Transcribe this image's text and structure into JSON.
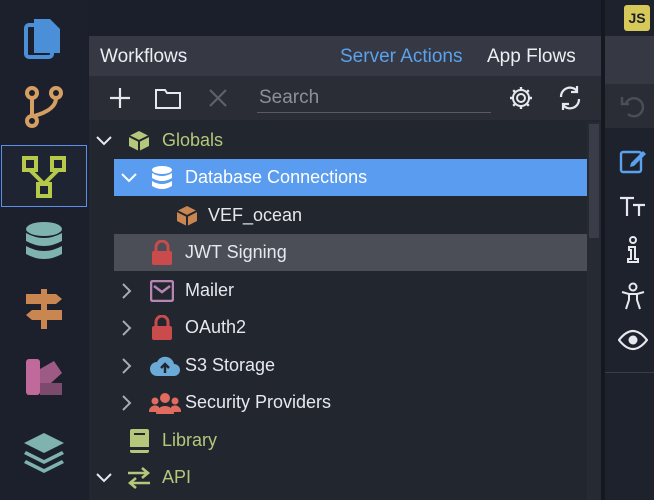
{
  "panel": {
    "title": "Workflows",
    "tabs": [
      "Server Actions",
      "App Flows"
    ]
  },
  "toolbar": {
    "search_placeholder": "Search",
    "buttons": [
      "add-icon",
      "new-folder-icon",
      "delete-icon",
      "settings-icon",
      "refresh-icon"
    ]
  },
  "tree": {
    "items": [
      {
        "label": "Globals",
        "icon": "cube-icon",
        "expanded": true
      },
      {
        "label": "Database Connections",
        "icon": "database-icon",
        "expanded": true,
        "selected": true
      },
      {
        "label": "VEF_ocean",
        "icon": "box-icon"
      },
      {
        "label": "JWT Signing",
        "icon": "lock-icon"
      },
      {
        "label": "Mailer",
        "icon": "mail-icon",
        "expanded": false
      },
      {
        "label": "OAuth2",
        "icon": "lock-icon",
        "expanded": false
      },
      {
        "label": "S3 Storage",
        "icon": "cloud-upload-icon",
        "expanded": false
      },
      {
        "label": "Security Providers",
        "icon": "users-icon",
        "expanded": false
      },
      {
        "label": "Library",
        "icon": "book-icon"
      },
      {
        "label": "API",
        "icon": "exchange-icon",
        "expanded": true
      }
    ]
  },
  "right": {
    "badge": "JS"
  },
  "colors": {
    "accent": "#5a9cf0",
    "tab_active": "#5aa1ee",
    "green_label": "#b5c77a",
    "lock": "#c94b4b"
  }
}
